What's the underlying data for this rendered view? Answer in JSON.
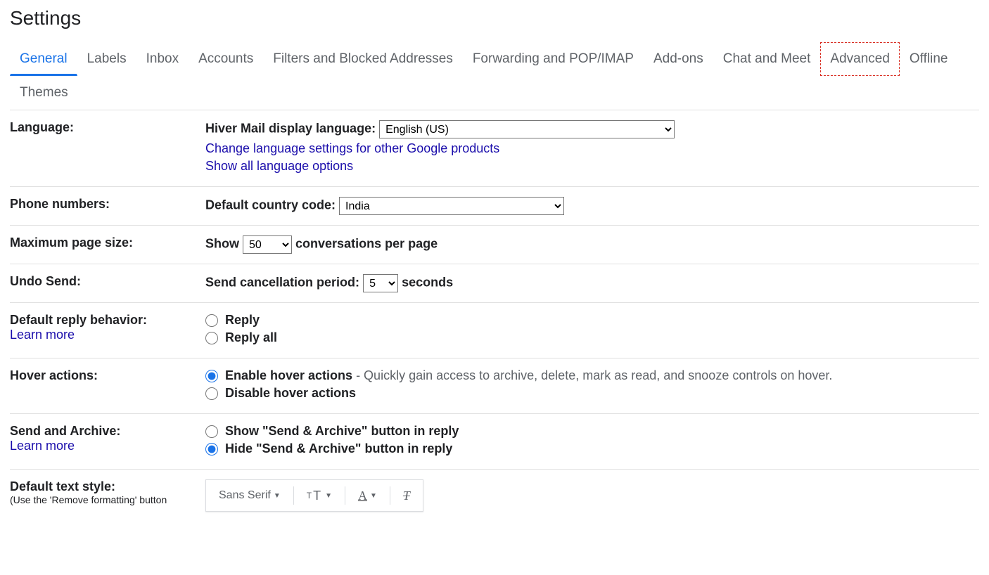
{
  "title": "Settings",
  "tabs": [
    "General",
    "Labels",
    "Inbox",
    "Accounts",
    "Filters and Blocked Addresses",
    "Forwarding and POP/IMAP",
    "Add-ons",
    "Chat and Meet",
    "Advanced",
    "Offline",
    "Themes"
  ],
  "active_tab": "General",
  "highlight_tab": "Advanced",
  "language": {
    "label": "Language:",
    "display_label": "Hiver Mail display language:",
    "value": "English (US)",
    "change_link": "Change language settings for other Google products",
    "show_all": "Show all language options"
  },
  "phone": {
    "label": "Phone numbers:",
    "cc_label": "Default country code:",
    "value": "India"
  },
  "page_size": {
    "label": "Maximum page size:",
    "prefix": "Show",
    "value": "50",
    "suffix": "conversations per page"
  },
  "undo": {
    "label": "Undo Send:",
    "prefix": "Send cancellation period:",
    "value": "5",
    "suffix": "seconds"
  },
  "reply": {
    "label": "Default reply behavior:",
    "learn": "Learn more",
    "opt1": "Reply",
    "opt2": "Reply all",
    "selected": "none"
  },
  "hover": {
    "label": "Hover actions:",
    "opt1": "Enable hover actions",
    "opt1_desc": " - Quickly gain access to archive, delete, mark as read, and snooze controls on hover.",
    "opt2": "Disable hover actions",
    "selected": "enable"
  },
  "send_archive": {
    "label": "Send and Archive:",
    "learn": "Learn more",
    "opt1": "Show \"Send & Archive\" button in reply",
    "opt2": "Hide \"Send & Archive\" button in reply",
    "selected": "hide"
  },
  "text_style": {
    "label": "Default text style:",
    "note": "(Use the 'Remove formatting' button",
    "font_name": "Sans Serif"
  }
}
